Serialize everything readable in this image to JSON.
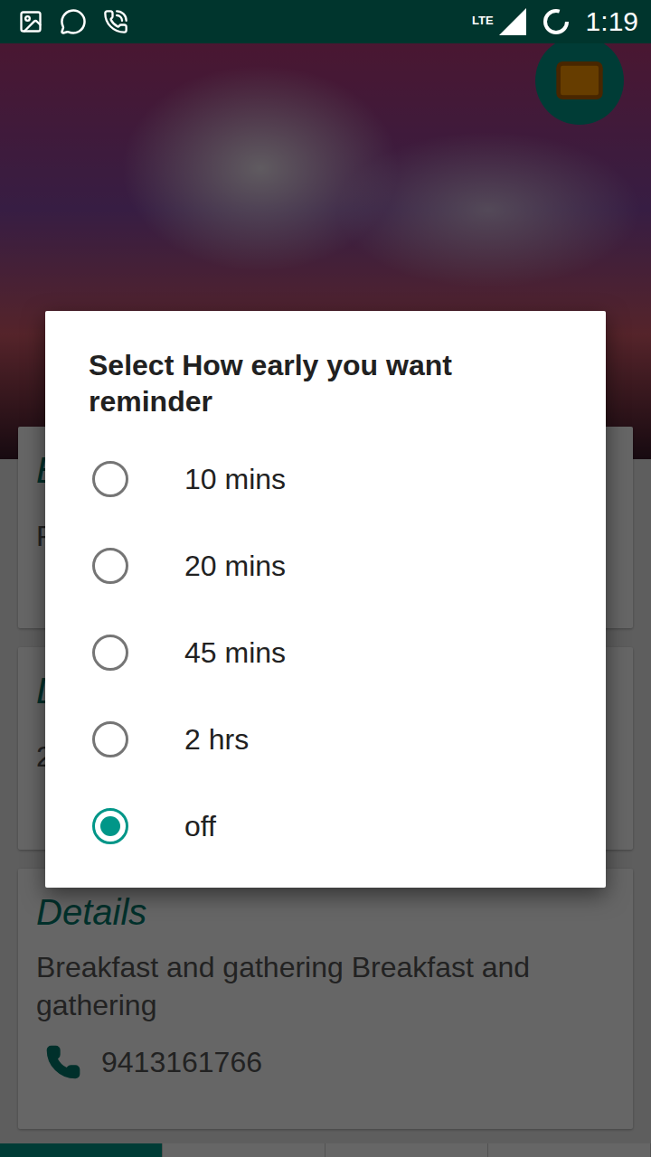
{
  "status_bar": {
    "network": "LTE",
    "time": "1:19"
  },
  "cards": [
    {
      "title": "E",
      "value": "P"
    },
    {
      "title": "D",
      "value": "2"
    }
  ],
  "details": {
    "title": "Details",
    "text": "Breakfast and gathering Breakfast and gathering",
    "phone": "9413161766"
  },
  "dialog": {
    "title": "Select How early you want reminder",
    "options": [
      {
        "label": "10 mins",
        "selected": false
      },
      {
        "label": "20 mins",
        "selected": false
      },
      {
        "label": "45 mins",
        "selected": false
      },
      {
        "label": "2 hrs",
        "selected": false
      },
      {
        "label": "off",
        "selected": true
      }
    ]
  },
  "bottom_tabs": [
    {
      "selected": true
    },
    {
      "selected": false
    },
    {
      "selected": false
    },
    {
      "selected": false
    }
  ]
}
